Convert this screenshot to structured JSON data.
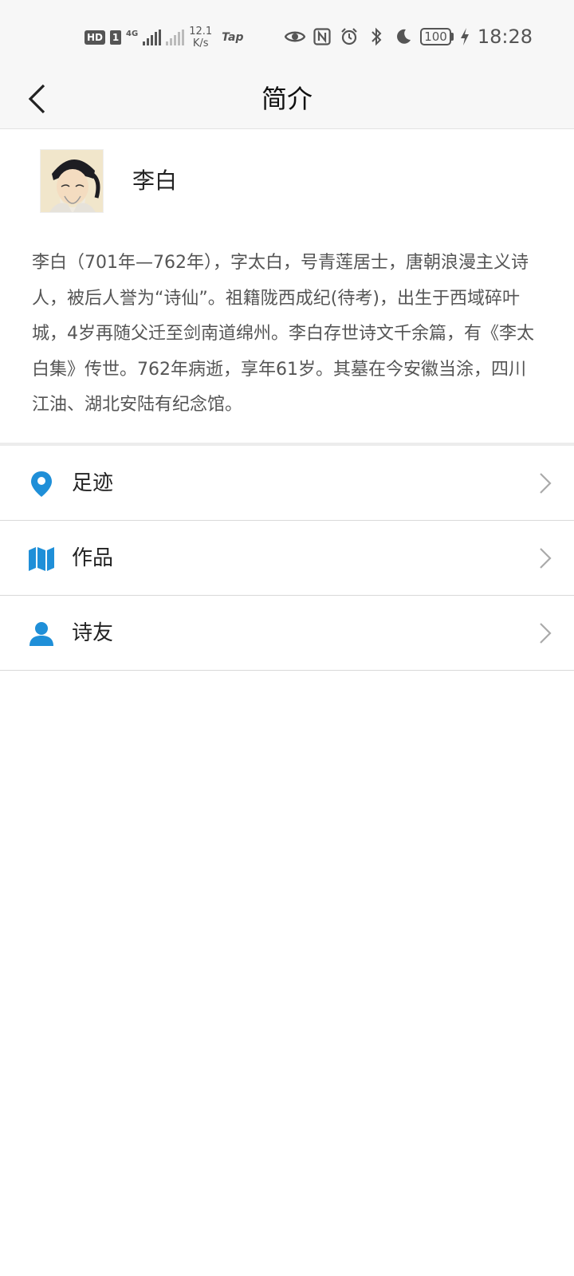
{
  "status_bar": {
    "hd": "HD",
    "sim": "1",
    "network": "4G",
    "speed_value": "12.1",
    "speed_unit": "K/s",
    "app_badge": "Tap",
    "battery": "100",
    "time": "18:28",
    "icons": [
      "eye-icon",
      "nfc-icon",
      "alarm-icon",
      "bluetooth-icon",
      "moon-icon",
      "charging-icon"
    ]
  },
  "header": {
    "title": "简介"
  },
  "profile": {
    "name": "李白",
    "intro": "李白（701年—762年），字太白，号青莲居士，唐朝浪漫主义诗人，被后人誉为“诗仙”。祖籍陇西成纪(待考)，出生于西域碎叶城，4岁再随父迁至剑南道绵州。李白存世诗文千余篇，有《李太白集》传世。762年病逝，享年61岁。其墓在今安徽当涂，四川江油、湖北安陆有纪念馆。"
  },
  "menu": [
    {
      "label": "足迹",
      "icon": "location-pin-icon"
    },
    {
      "label": "作品",
      "icon": "map-icon"
    },
    {
      "label": "诗友",
      "icon": "person-icon"
    }
  ],
  "colors": {
    "accent": "#1f8fd8",
    "text_primary": "#222222",
    "text_secondary": "#555555",
    "bar_background": "#f7f7f7"
  }
}
